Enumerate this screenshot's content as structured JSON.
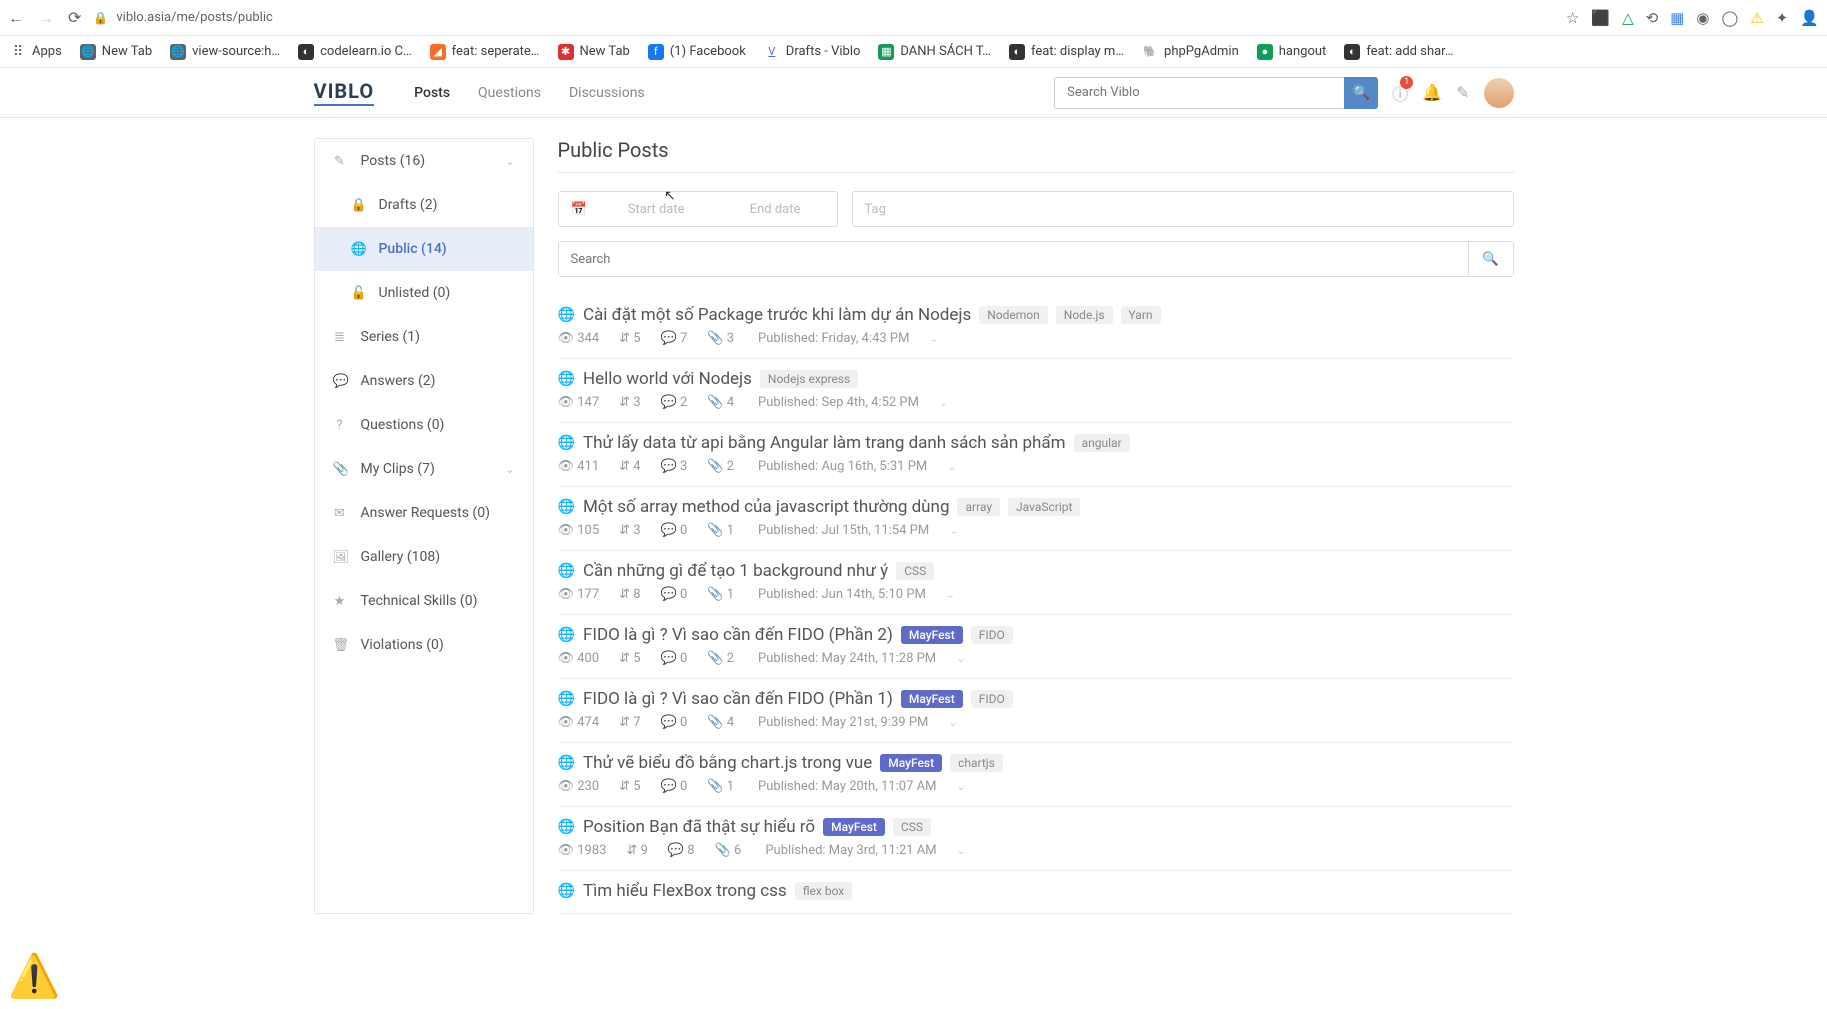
{
  "browser": {
    "url": "viblo.asia/me/posts/public",
    "bookmarks": [
      {
        "label": "Apps",
        "color": "#ea4335"
      },
      {
        "label": "New Tab",
        "color": "#5f6368"
      },
      {
        "label": "view-source:h…",
        "color": "#5f6368"
      },
      {
        "label": "codelearn.io C…",
        "color": "#333"
      },
      {
        "label": "feat: seperate…",
        "color": "#fc6d26"
      },
      {
        "label": "New Tab",
        "color": "#e03131"
      },
      {
        "label": "(1) Facebook",
        "color": "#1877f2"
      },
      {
        "label": "Drafts - Viblo",
        "color": "#4a6fcc"
      },
      {
        "label": "DANH SÁCH T…",
        "color": "#0f9d58"
      },
      {
        "label": "feat: display m…",
        "color": "#333"
      },
      {
        "label": "phpPgAdmin",
        "color": "#888"
      },
      {
        "label": "hangout",
        "color": "#0f9d58"
      },
      {
        "label": "feat: add shar…",
        "color": "#333"
      }
    ]
  },
  "header": {
    "logo": "VIBLO",
    "nav": [
      "Posts",
      "Questions",
      "Discussions"
    ],
    "search_placeholder": "Search Viblo",
    "notif_count": "1"
  },
  "sidebar": [
    {
      "icon": "✎",
      "label": "Posts (16)",
      "expand": true
    },
    {
      "icon": "🔒",
      "label": "Drafts (2)",
      "sub": true
    },
    {
      "icon": "🌐",
      "label": "Public (14)",
      "sub": true,
      "active": true
    },
    {
      "icon": "🔓",
      "label": "Unlisted (0)",
      "sub": true
    },
    {
      "icon": "≣",
      "label": "Series (1)"
    },
    {
      "icon": "💬",
      "label": "Answers (2)"
    },
    {
      "icon": "?",
      "label": "Questions (0)"
    },
    {
      "icon": "📎",
      "label": "My Clips (7)",
      "expand": true
    },
    {
      "icon": "✉",
      "label": "Answer Requests (0)"
    },
    {
      "icon": "🖼",
      "label": "Gallery (108)"
    },
    {
      "icon": "★",
      "label": "Technical Skills (0)"
    },
    {
      "icon": "🗑",
      "label": "Violations (0)"
    }
  ],
  "page": {
    "title": "Public Posts",
    "start_date": "Start date",
    "end_date": "End date",
    "tag_placeholder": "Tag",
    "search_placeholder": "Search"
  },
  "posts": [
    {
      "title": "Cài đặt một số Package trước khi làm dự án Nodejs",
      "tags": [
        "Nodemon",
        "Node.js",
        "Yarn"
      ],
      "views": "344",
      "score": "5",
      "comments": "7",
      "clips": "3",
      "pub": "Published: Friday, 4:43 PM"
    },
    {
      "title": "Hello world với Nodejs",
      "tags": [
        "Nodejs express"
      ],
      "views": "147",
      "score": "3",
      "comments": "2",
      "clips": "4",
      "pub": "Published: Sep 4th, 4:52 PM"
    },
    {
      "title": "Thử lấy data từ api bằng Angular làm trang danh sách sản phẩm",
      "tags": [
        "angular"
      ],
      "views": "411",
      "score": "4",
      "comments": "3",
      "clips": "2",
      "pub": "Published: Aug 16th, 5:31 PM"
    },
    {
      "title": "Một số array method của javascript thường dùng",
      "tags": [
        "array",
        "JavaScript"
      ],
      "views": "105",
      "score": "3",
      "comments": "0",
      "clips": "1",
      "pub": "Published: Jul 15th, 11:54 PM"
    },
    {
      "title": "Cần những gì để tạo 1 background như ý",
      "tags": [
        "CSS"
      ],
      "views": "177",
      "score": "8",
      "comments": "0",
      "clips": "1",
      "pub": "Published: Jun 14th, 5:10 PM"
    },
    {
      "title": "FIDO là gì ? Vì sao cần đến FIDO (Phần 2)",
      "badge": "MayFest",
      "tags": [
        "FIDO"
      ],
      "views": "400",
      "score": "5",
      "comments": "0",
      "clips": "2",
      "pub": "Published: May 24th, 11:28 PM"
    },
    {
      "title": "FIDO là gì ? Vì sao cần đến FIDO (Phần 1)",
      "badge": "MayFest",
      "tags": [
        "FIDO"
      ],
      "views": "474",
      "score": "7",
      "comments": "0",
      "clips": "4",
      "pub": "Published: May 21st, 9:39 PM"
    },
    {
      "title": "Thử vẽ biểu đồ bằng chart.js trong vue",
      "badge": "MayFest",
      "tags": [
        "chartjs"
      ],
      "views": "230",
      "score": "5",
      "comments": "0",
      "clips": "1",
      "pub": "Published: May 20th, 11:07 AM"
    },
    {
      "title": "Position Bạn đã thật sự hiểu rõ",
      "badge": "MayFest",
      "tags": [
        "CSS"
      ],
      "views": "1983",
      "score": "9",
      "comments": "8",
      "clips": "6",
      "pub": "Published: May 3rd, 11:21 AM"
    },
    {
      "title": "Tìm hiểu FlexBox trong css",
      "tags": [
        "flex box"
      ],
      "views": "",
      "score": "",
      "comments": "",
      "clips": "",
      "pub": ""
    }
  ]
}
